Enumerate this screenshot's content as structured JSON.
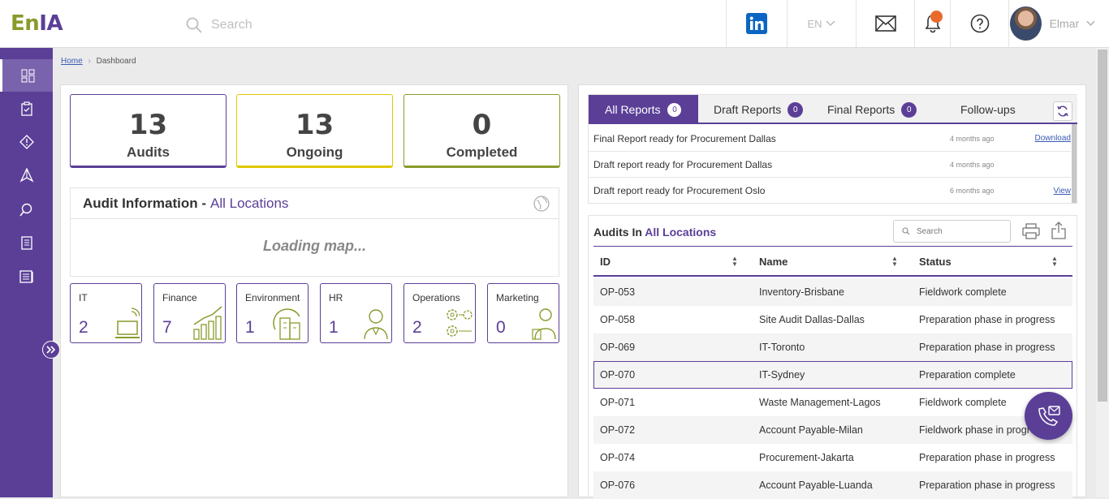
{
  "logo": {
    "part1": "En",
    "part2": "IA"
  },
  "header": {
    "search_placeholder": "Search",
    "language": "EN",
    "user_name": "Elmar"
  },
  "breadcrumb": {
    "home": "Home",
    "current": "Dashboard"
  },
  "stats": [
    {
      "value": "13",
      "label": "Audits",
      "color": "#5b3f97"
    },
    {
      "value": "13",
      "label": "Ongoing",
      "color": "#e0c800"
    },
    {
      "value": "0",
      "label": "Completed",
      "color": "#8a9a2b"
    }
  ],
  "audit_info": {
    "title": "Audit Information - ",
    "location": "All Locations",
    "loading": "Loading map..."
  },
  "categories": [
    {
      "name": "IT",
      "count": "2",
      "icon": "laptop-icon"
    },
    {
      "name": "Finance",
      "count": "7",
      "icon": "bar-chart-icon"
    },
    {
      "name": "Environment",
      "count": "1",
      "icon": "building-icon"
    },
    {
      "name": "HR",
      "count": "1",
      "icon": "person-icon"
    },
    {
      "name": "Operations",
      "count": "2",
      "icon": "gears-icon"
    },
    {
      "name": "Marketing",
      "count": "0",
      "icon": "presenter-icon"
    }
  ],
  "report_tabs": [
    {
      "label": "All Reports",
      "count": "0"
    },
    {
      "label": "Draft Reports",
      "count": "0"
    },
    {
      "label": "Final Reports",
      "count": "0"
    },
    {
      "label": "Follow-ups"
    }
  ],
  "reports": [
    {
      "text": "Final Report ready for Procurement Dallas",
      "time": "4 months ago",
      "action": "Download"
    },
    {
      "text": "Draft report ready for Procurement Dallas",
      "time": "4 months ago",
      "action": ""
    },
    {
      "text": "Draft report ready for Procurement Oslo",
      "time": "6 months ago",
      "action": "View"
    }
  ],
  "audits": {
    "title": "Audits In ",
    "location": "All Locations",
    "search_placeholder": "Search",
    "columns": [
      "ID",
      "Name",
      "Status"
    ],
    "rows": [
      [
        "OP-053",
        "Inventory-Brisbane",
        "Fieldwork complete"
      ],
      [
        "OP-058",
        "Site Audit Dallas-Dallas",
        "Preparation phase in progress"
      ],
      [
        "OP-069",
        "IT-Toronto",
        "Preparation phase in progress"
      ],
      [
        "OP-070",
        "IT-Sydney",
        "Preparation complete"
      ],
      [
        "OP-071",
        "Waste Management-Lagos",
        "Fieldwork complete"
      ],
      [
        "OP-072",
        "Account Payable-Milan",
        "Fieldwork phase in progress"
      ],
      [
        "OP-074",
        "Procurement-Jakarta",
        "Preparation phase in progress"
      ],
      [
        "OP-076",
        "Account Payable-Luanda",
        "Preparation phase in progress"
      ]
    ]
  }
}
